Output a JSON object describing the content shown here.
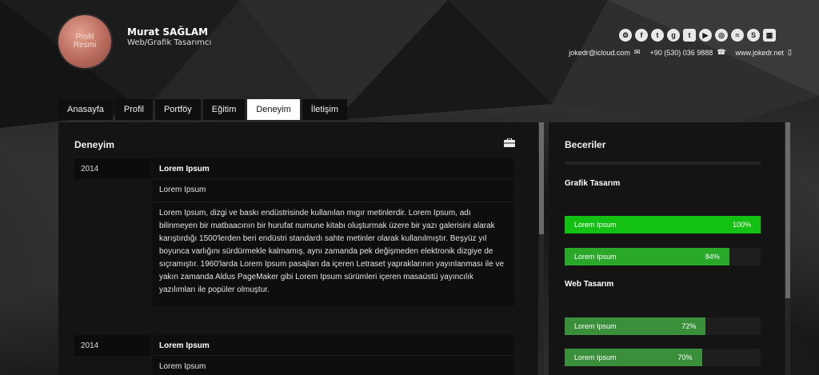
{
  "profile": {
    "avatar_text": "Profil Resmi",
    "name": "Murat SAĞLAM",
    "role": "Web/Grafik Tasarımcı"
  },
  "social_icons": [
    "steam-icon",
    "facebook-icon",
    "twitter-icon",
    "google-plus-icon",
    "tumblr-icon",
    "youtube-icon",
    "instagram-icon",
    "blog-icon",
    "skype-icon",
    "phone-icon"
  ],
  "contact": {
    "email": "jokedr@icloud.com",
    "phone": "+90 (530) 036 9888",
    "website": "www.jokedr.net"
  },
  "nav": {
    "tabs": [
      {
        "label": "Anasayfa"
      },
      {
        "label": "Profil"
      },
      {
        "label": "Portföy"
      },
      {
        "label": "Eğitim"
      },
      {
        "label": "Deneyim",
        "active": true
      },
      {
        "label": "İletişim"
      }
    ]
  },
  "experience": {
    "title": "Deneyim",
    "entries": [
      {
        "year": "2014",
        "title": "Lorem Ipsum",
        "subtitle": "Lorem Ipsum",
        "body": "Lorem Ipsum, dizgi ve baskı endüstrisinde kullanılan mıgır metinlerdir. Lorem Ipsum, adı bilinmeyen bir matbaacının bir hurufat numune kitabı oluşturmak üzere bir yazı galerisini alarak karıştırdığı 1500'lerden beri endüstri standardı sahte metinler olarak kullanılmıştır. Beşyüz yıl boyunca varlığını sürdürmekle kalmamış, aynı zamanda pek değişmeden elektronik dizgiye de sıçramıştır. 1960'larda Lorem Ipsum pasajları da içeren Letraset yapraklarının yayınlanması ile ve yakın zamanda Aldus PageMaker gibi Lorem Ipsum sürümleri içeren masaüstü yayıncılık yazılımları ile popüler olmuştur."
      },
      {
        "year": "2014",
        "title": "Lorem Ipsum",
        "subtitle": "Lorem Ipsum"
      }
    ]
  },
  "skills": {
    "title": "Beceriler",
    "groups": [
      {
        "name": "Grafik Tasarım",
        "items": [
          {
            "label": "Lorem Ipsum",
            "percent_text": "100%",
            "level": 1.0,
            "color": "#12c112"
          },
          {
            "label": "Lorem Ipsum",
            "percent_text": "84%",
            "level": 0.84,
            "color": "#2aa82a"
          }
        ]
      },
      {
        "name": "Web Tasarım",
        "items": [
          {
            "label": "Lorem Ipsum",
            "percent_text": "72%",
            "level": 0.72,
            "color": "#3a8f3a"
          },
          {
            "label": "Lorem Ipsum",
            "percent_text": "70%",
            "level": 0.7,
            "color": "#3a8f3a"
          }
        ]
      }
    ]
  }
}
